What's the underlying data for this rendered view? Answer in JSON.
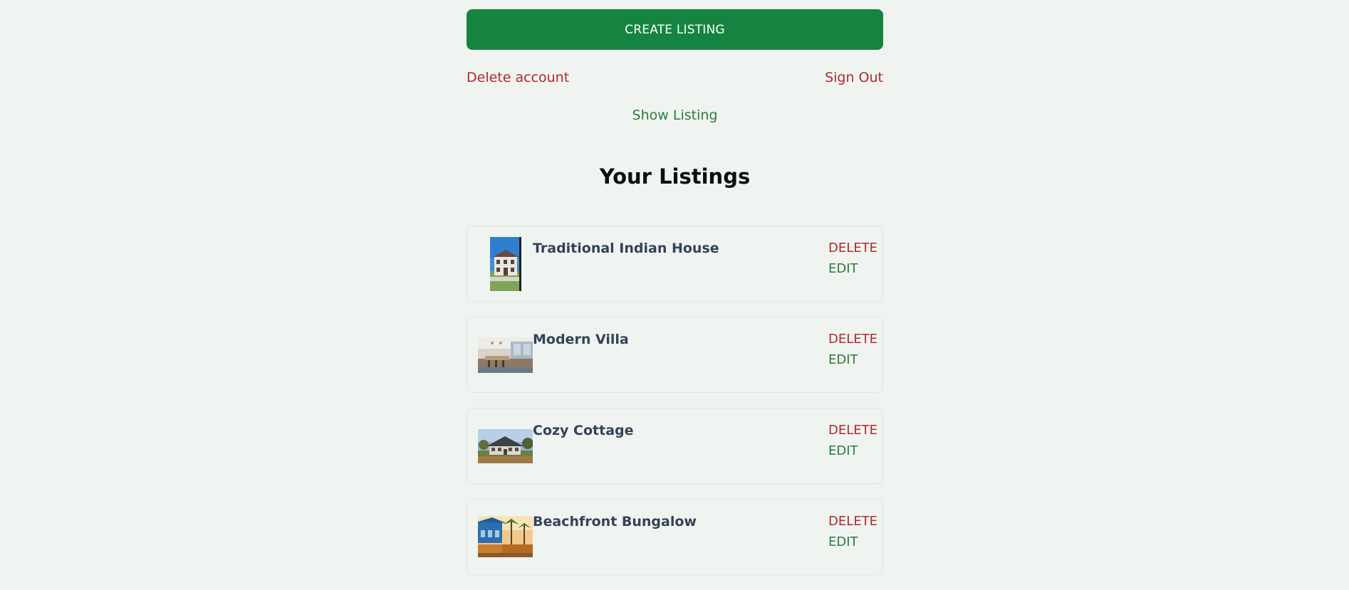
{
  "actions": {
    "create_label": "CREATE LISTING",
    "delete_account_label": "Delete account",
    "sign_out_label": "Sign Out",
    "show_listing_label": "Show Listing"
  },
  "section": {
    "title": "Your Listings"
  },
  "listings": [
    {
      "name": "Traditional Indian House",
      "delete_label": "DELETE",
      "edit_label": "EDIT"
    },
    {
      "name": "Modern Villa",
      "delete_label": "DELETE",
      "edit_label": "EDIT"
    },
    {
      "name": "Cozy Cottage",
      "delete_label": "DELETE",
      "edit_label": "EDIT"
    },
    {
      "name": "Beachfront Bungalow",
      "delete_label": "DELETE",
      "edit_label": "EDIT"
    }
  ],
  "colors": {
    "primary_green": "#158440",
    "link_green": "#2b7a3d",
    "danger_red": "#b3282d",
    "background": "#f0f4f1"
  }
}
